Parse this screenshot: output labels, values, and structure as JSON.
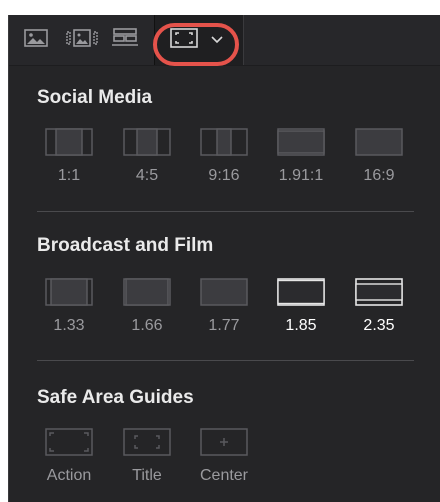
{
  "toolbar": {
    "buttons": [
      {
        "name": "image-view-icon"
      },
      {
        "name": "filmstrip-view-icon"
      },
      {
        "name": "grid-view-icon"
      },
      {
        "name": "aspect-frame-icon"
      },
      {
        "name": "chevron-down-icon"
      }
    ],
    "highlight_color": "#e5534b"
  },
  "social_media": {
    "title": "Social Media",
    "options": [
      {
        "label": "1:1",
        "active": false
      },
      {
        "label": "4:5",
        "active": false
      },
      {
        "label": "9:16",
        "active": false
      },
      {
        "label": "1.91:1",
        "active": false
      },
      {
        "label": "16:9",
        "active": false
      }
    ]
  },
  "broadcast": {
    "title": "Broadcast and Film",
    "options": [
      {
        "label": "1.33",
        "active": false
      },
      {
        "label": "1.66",
        "active": false
      },
      {
        "label": "1.77",
        "active": false
      },
      {
        "label": "1.85",
        "active": true
      },
      {
        "label": "2.35",
        "active": true
      }
    ]
  },
  "safe_area": {
    "title": "Safe Area Guides",
    "options": [
      {
        "label": "Action",
        "active": false
      },
      {
        "label": "Title",
        "active": false
      },
      {
        "label": "Center",
        "active": false
      }
    ]
  },
  "colors": {
    "panel_bg": "#252527",
    "inactive_icon": "#5a5a5e",
    "active_icon": "#e6e6e6",
    "inactive_label": "#9a9a9e",
    "active_label": "#ffffff"
  }
}
